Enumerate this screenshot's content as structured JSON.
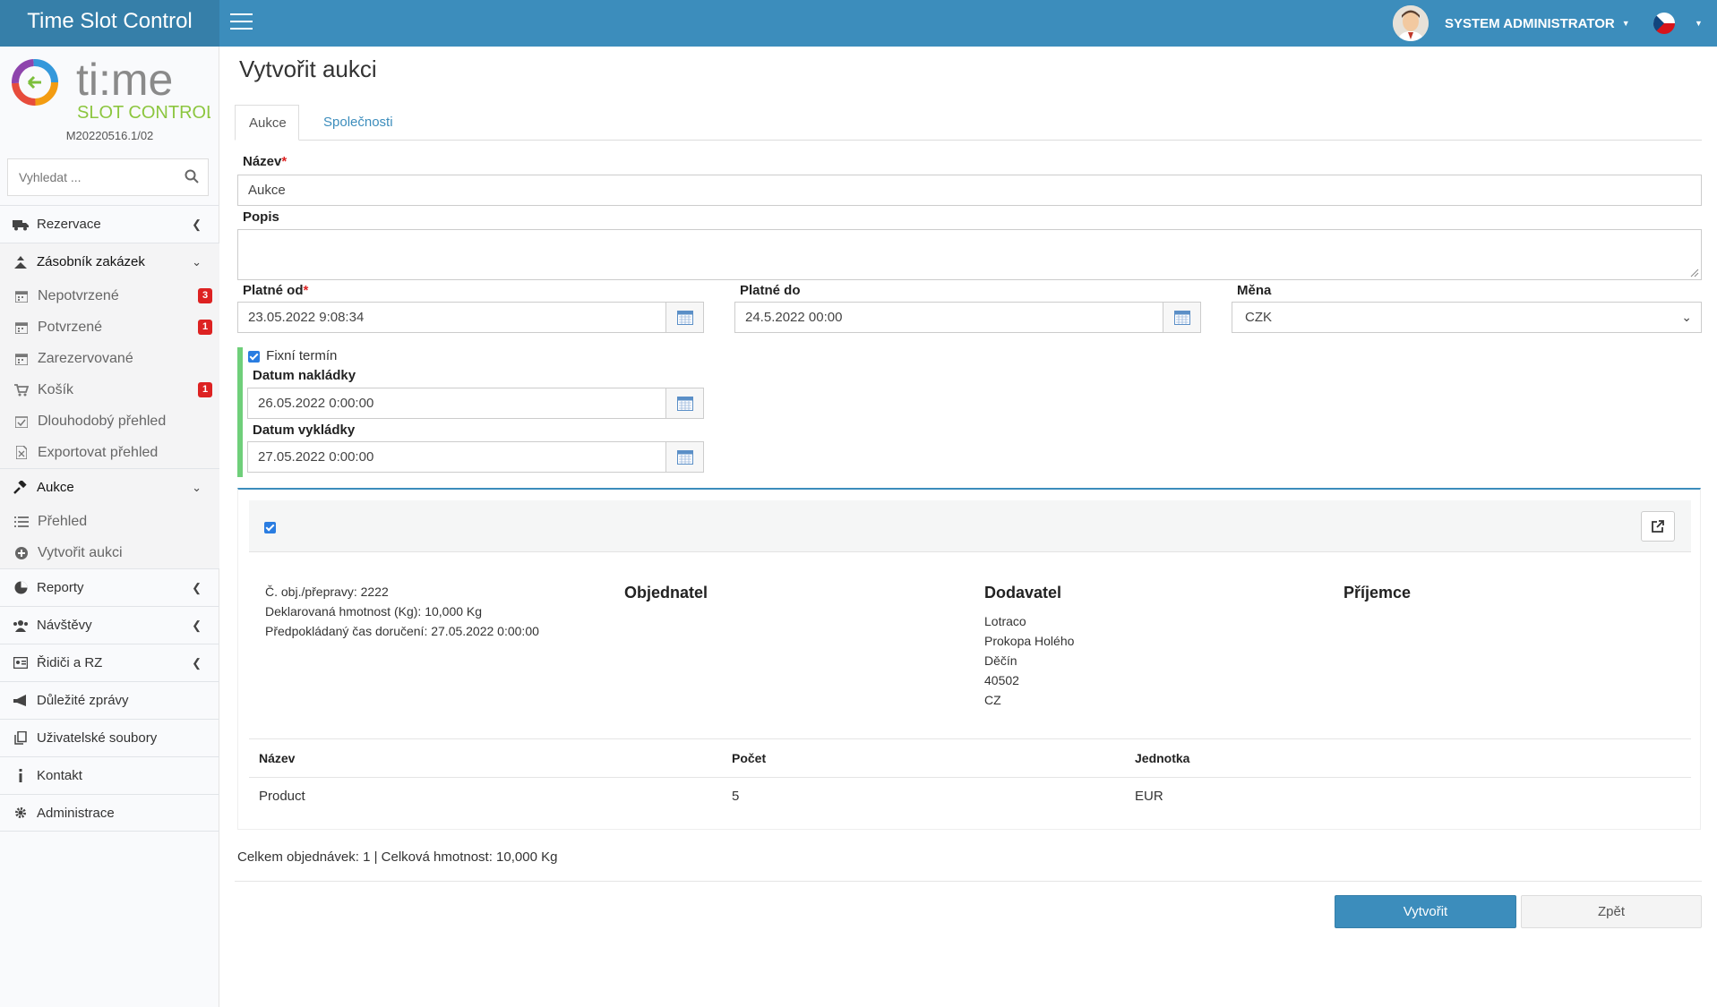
{
  "header": {
    "brand": "Time Slot Control",
    "user_name": "SYSTEM ADMINISTRATOR",
    "language_flag": "cz-flag",
    "accent": "#3c8dbc"
  },
  "sidebar": {
    "logo_text": "ti:me",
    "logo_sub": "SLOT CONTROL",
    "version": "M20220516.1/02",
    "search_placeholder": "Vyhledat ...",
    "items": [
      {
        "label": "Rezervace",
        "icon": "truck-icon"
      },
      {
        "label": "Zásobník zakázek",
        "icon": "cubes-icon"
      },
      {
        "label": "Nepotvrzené",
        "icon": "calendar-icon",
        "badge": "3"
      },
      {
        "label": "Potvrzené",
        "icon": "calendar-icon",
        "badge": "1"
      },
      {
        "label": "Zarezervované",
        "icon": "calendar-icon"
      },
      {
        "label": "Košík",
        "icon": "cart-icon",
        "badge": "1"
      },
      {
        "label": "Dlouhodobý přehled",
        "icon": "calendar-check-icon"
      },
      {
        "label": "Exportovat přehled",
        "icon": "file-excel-icon"
      },
      {
        "label": "Aukce",
        "icon": "gavel-icon"
      },
      {
        "label": "Přehled",
        "icon": "list-icon"
      },
      {
        "label": "Vytvořit aukci",
        "icon": "plus-circle-icon"
      },
      {
        "label": "Reporty",
        "icon": "pie-chart-icon"
      },
      {
        "label": "Návštěvy",
        "icon": "users-icon"
      },
      {
        "label": "Řidiči a RZ",
        "icon": "id-card-icon"
      },
      {
        "label": "Důležité zprávy",
        "icon": "bullhorn-icon"
      },
      {
        "label": "Uživatelské soubory",
        "icon": "files-icon"
      },
      {
        "label": "Kontakt",
        "icon": "info-icon"
      },
      {
        "label": "Administrace",
        "icon": "gear-icon"
      }
    ]
  },
  "main": {
    "title": "Vytvořit aukci",
    "tabs": [
      {
        "label": "Aukce"
      },
      {
        "label": "Společnosti"
      }
    ],
    "form": {
      "name_label": "Název",
      "name_value": "Aukce",
      "desc_label": "Popis",
      "desc_value": "",
      "valid_from_label": "Platné od",
      "valid_from_value": "23.05.2022 9:08:34",
      "valid_to_label": "Platné do",
      "valid_to_value": "24.5.2022 00:00",
      "currency_label": "Měna",
      "currency_value": "CZK",
      "fixed_term_label": "Fixní termín",
      "loading_label": "Datum nakládky",
      "loading_value": "26.05.2022 0:00:00",
      "unloading_label": "Datum vykládky",
      "unloading_value": "27.05.2022 0:00:00"
    },
    "order": {
      "order_no": "Č. obj./přepravy: 2222",
      "weight": "Deklarovaná hmotnost (Kg): 10,000 Kg",
      "delivery": "Předpokládaný čas doručení: 27.05.2022 0:00:00",
      "orderer_title": "Objednatel",
      "supplier_title": "Dodavatel",
      "recipient_title": "Příjemce",
      "supplier_address": [
        "Lotraco",
        "Prokopa Holého",
        "Děčín",
        "40502",
        "CZ"
      ],
      "table_headers": [
        "Název",
        "Počet",
        "Jednotka"
      ],
      "rows": [
        [
          "Product",
          "5",
          "EUR"
        ]
      ]
    },
    "summary": "Celkem objednávek: 1 | Celková hmotnost: 10,000 Kg",
    "create_label": "Vytvořit",
    "back_label": "Zpět"
  }
}
